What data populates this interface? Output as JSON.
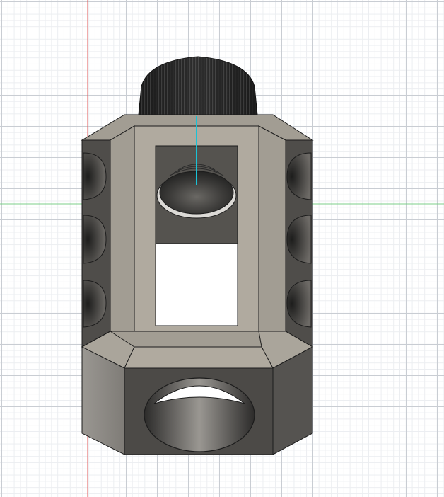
{
  "viewport": {
    "background": "#ffffff",
    "grid_major": "#c9cdd3",
    "grid_minor": "#eceef1"
  },
  "axes": {
    "vertical_axis_color": "#e35a5a",
    "horizontal_axis_color": "#7ccf8a",
    "selection_axis_color": "#19c2d6"
  },
  "model": {
    "body_face": "#b0aa9f",
    "chamfer_face": "#a29d93",
    "side_face_dark": "#4f4d4a",
    "side_face_light": "#8f8b85",
    "edge": "#1c1c1c",
    "knurl": "#1e1e1e",
    "bore_dark": "#3e3d3b",
    "bore_light": "#8a8782"
  }
}
